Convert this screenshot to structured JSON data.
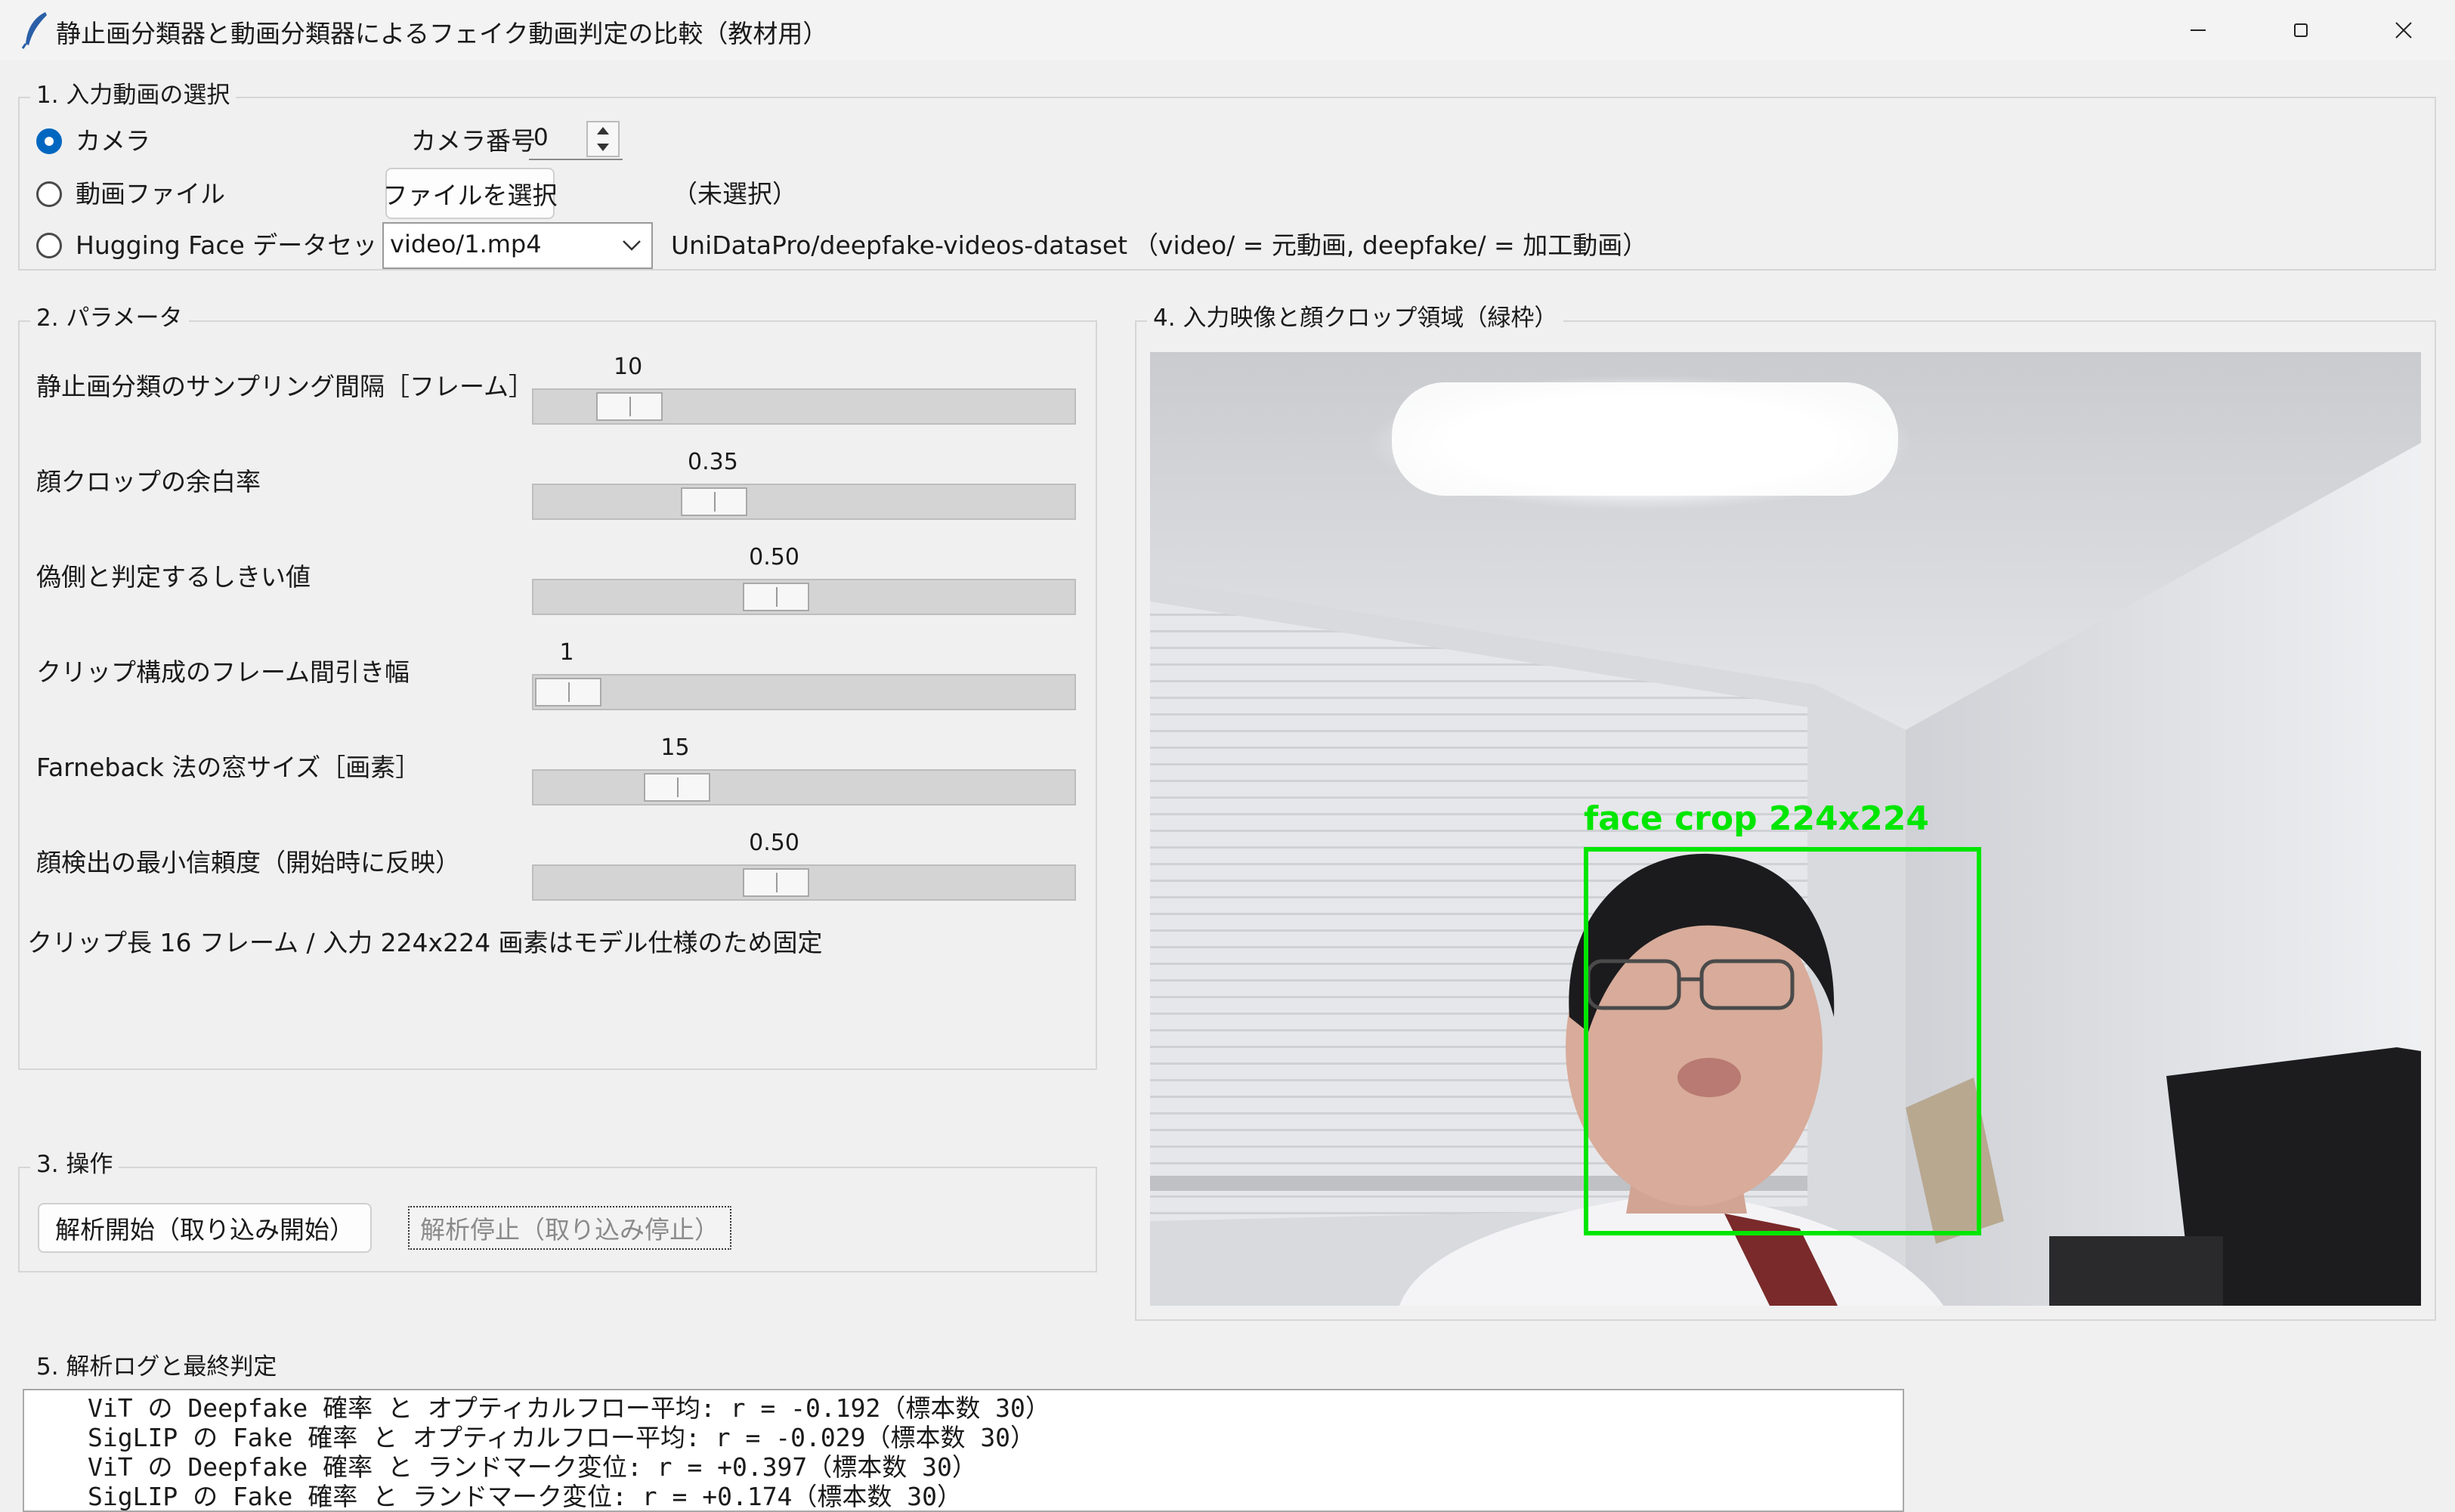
{
  "window": {
    "title": "静止画分類器と動画分類器によるフェイク動画判定の比較（教材用）",
    "controls": [
      "minimize-icon",
      "maximize-icon",
      "close-icon"
    ]
  },
  "input_section": {
    "legend": "1. 入力動画の選択",
    "camera_radio_label": "カメラ",
    "camera_number_label": "カメラ番号",
    "camera_number_value": "0",
    "video_file_radio_label": "動画ファイル",
    "select_file_button": "ファイルを選択",
    "file_status": "（未選択）",
    "hf_radio_label": "Hugging Face データセット",
    "hf_selected": "video/1.mp4",
    "hf_dataset_name": "UniDataPro/deepfake-videos-dataset",
    "hf_note": "（video/ = 元動画, deepfake/ = 加工動画）",
    "selected": "camera"
  },
  "params_section": {
    "legend": "2. パラメータ",
    "sliders": [
      {
        "label": "静止画分類のサンプリング間隔［フレーム］",
        "value_text": "10",
        "position": 0.13
      },
      {
        "label": "顔クロップの余白率",
        "value_text": "0.35",
        "position": 0.31
      },
      {
        "label": "偽側と判定するしきい値",
        "value_text": "0.50",
        "position": 0.44
      },
      {
        "label": "クリップ構成のフレーム間引き幅",
        "value_text": "1",
        "position": 0.0
      },
      {
        "label": "Farneback 法の窓サイズ［画素］",
        "value_text": "15",
        "position": 0.23
      },
      {
        "label": "顔検出の最小信頼度（開始時に反映）",
        "value_text": "0.50",
        "position": 0.44
      }
    ],
    "note": "クリップ長 16 フレーム / 入力 224x224 画素はモデル仕様のため固定"
  },
  "ops_section": {
    "legend": "3. 操作",
    "start_button": "解析開始（取り込み開始）",
    "stop_button": "解析停止（取り込み停止）"
  },
  "video_section": {
    "legend": "4. 入力映像と顔クロップ領域（緑枠）",
    "overlay_label": "face crop 224x224",
    "box_color": "#00e600"
  },
  "log_section": {
    "legend": "5. 解析ログと最終判定",
    "lines": [
      "ViT の Deepfake 確率 と オプティカルフロー平均: r = -0.192（標本数 30）",
      "SigLIP の Fake 確率 と オプティカルフロー平均: r = -0.029（標本数 30）",
      "ViT の Deepfake 確率 と ランドマーク変位: r = +0.397（標本数 30）",
      "SigLIP の Fake 確率 と ランドマーク変位: r = +0.174（標本数 30）"
    ]
  },
  "colors": {
    "accent": "#0067c0",
    "face_box": "#00e600"
  }
}
